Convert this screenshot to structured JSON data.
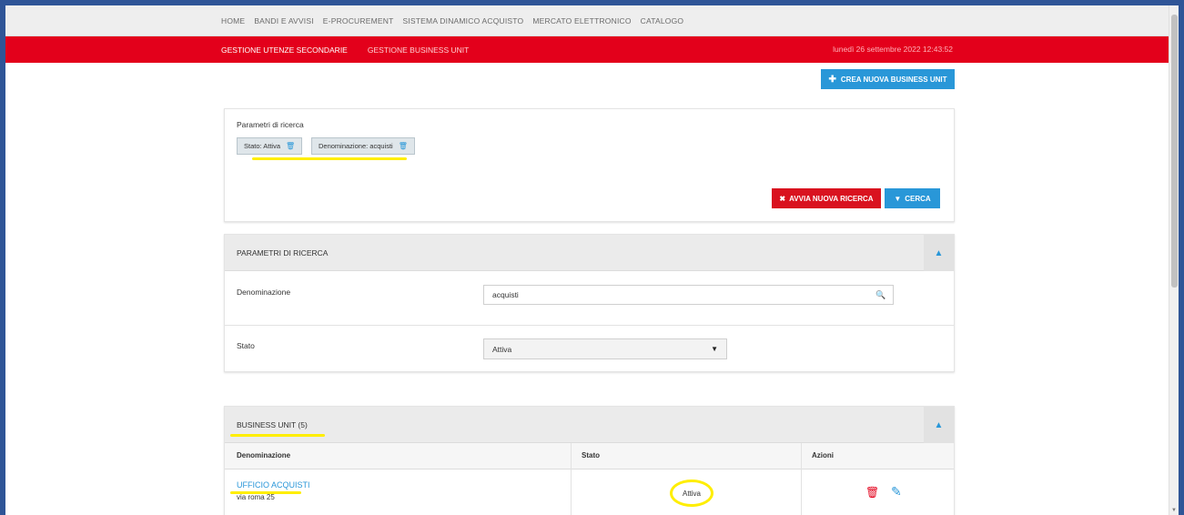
{
  "topnav": {
    "items": [
      "HOME",
      "BANDI E AVVISI",
      "E-PROCUREMENT",
      "SISTEMA DINAMICO ACQUISTO",
      "MERCATO ELETTRONICO",
      "CATALOGO"
    ]
  },
  "redbar": {
    "tab_users": "GESTIONE UTENZE SECONDARIE",
    "tab_business": "GESTIONE BUSINESS UNIT",
    "datetime": "lunedì 26 settembre 2022 12:43:52"
  },
  "actions": {
    "new_bu_label": "CREA NUOVA BUSINESS UNIT"
  },
  "summary": {
    "title": "Parametri di ricerca",
    "chips": [
      {
        "label": "Stato: Attiva"
      },
      {
        "label": "Denominazione: acquisti"
      }
    ],
    "reset_label": "AVVIA NUOVA RICERCA",
    "search_label": "CERCA"
  },
  "params": {
    "title": "PARAMETRI DI RICERCA",
    "name_label": "Denominazione",
    "name_value": "acquisti",
    "status_label": "Stato",
    "status_value": "Attiva"
  },
  "business_units": {
    "title": "BUSINESS UNIT (5)",
    "columns": [
      "Denominazione",
      "Stato",
      "Azioni"
    ],
    "rows": [
      {
        "name": "UFFICIO ACQUISTI",
        "address": "via roma 25",
        "status": "Attiva"
      }
    ]
  },
  "colors": {
    "primary_blue": "#2997d8",
    "brand_red": "#e3001b",
    "highlight_yellow": "#ffee00",
    "frame_border": "#2f5597"
  }
}
